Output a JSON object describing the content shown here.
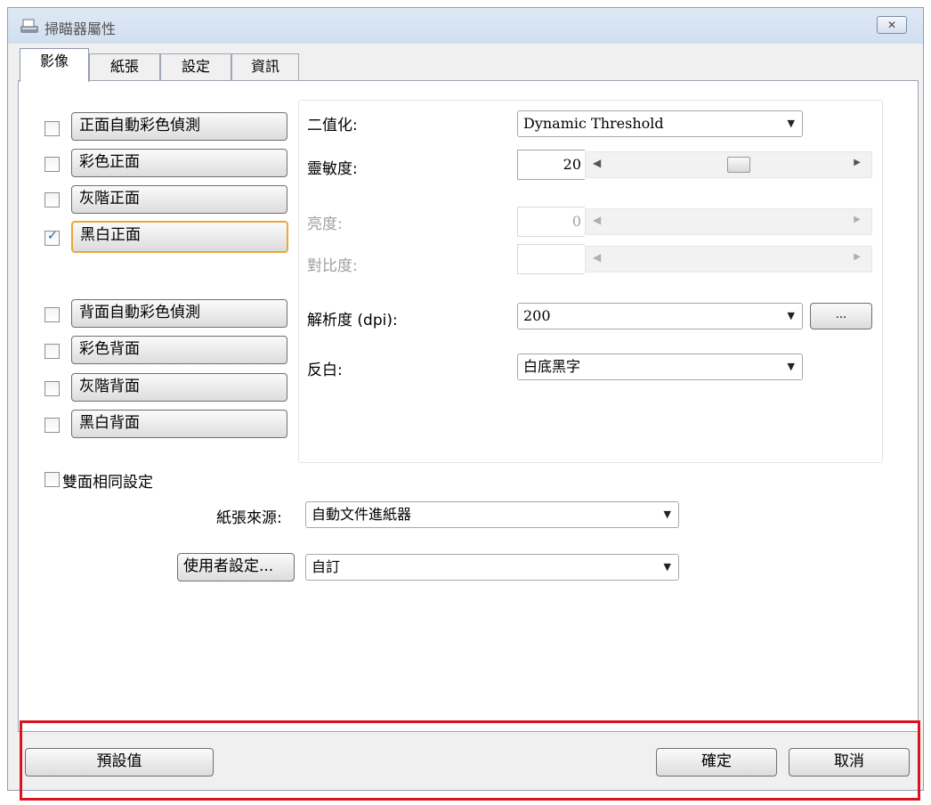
{
  "window": {
    "title": "掃瞄器屬性",
    "close_label": "✕"
  },
  "tabs": [
    {
      "label": "影像",
      "active": true
    },
    {
      "label": "紙張",
      "active": false
    },
    {
      "label": "設定",
      "active": false
    },
    {
      "label": "資訊",
      "active": false
    }
  ],
  "image_options": [
    {
      "label": "正面自動彩色偵測",
      "checked": false
    },
    {
      "label": "彩色正面",
      "checked": false
    },
    {
      "label": "灰階正面",
      "checked": false
    },
    {
      "label": "黑白正面",
      "checked": true
    },
    {
      "label": "背面自動彩色偵測",
      "checked": false
    },
    {
      "label": "彩色背面",
      "checked": false
    },
    {
      "label": "灰階背面",
      "checked": false
    },
    {
      "label": "黑白背面",
      "checked": false
    }
  ],
  "settings": {
    "binarization": {
      "label": "二值化:",
      "value": "Dynamic Threshold"
    },
    "sensitivity": {
      "label": "靈敏度:",
      "value": "20",
      "fraction": 0.55
    },
    "brightness": {
      "label": "亮度:",
      "value": "0"
    },
    "contrast": {
      "label": "對比度:",
      "value": ""
    },
    "resolution": {
      "label": "解析度 (dpi):",
      "value": "200",
      "more_label": "..."
    },
    "invert": {
      "label": "反白:",
      "value": "白底黑字"
    }
  },
  "duplex_same": {
    "label": "雙面相同設定",
    "checked": false
  },
  "paper_source": {
    "label": "紙張來源:",
    "value": "自動文件進紙器"
  },
  "user_settings": {
    "button_label": "使用者設定...",
    "value": "自訂"
  },
  "footer": {
    "default_label": "預設值",
    "ok_label": "確定",
    "cancel_label": "取消"
  },
  "colors": {
    "highlight": "#d9141f",
    "focus": "#e7a83d"
  }
}
